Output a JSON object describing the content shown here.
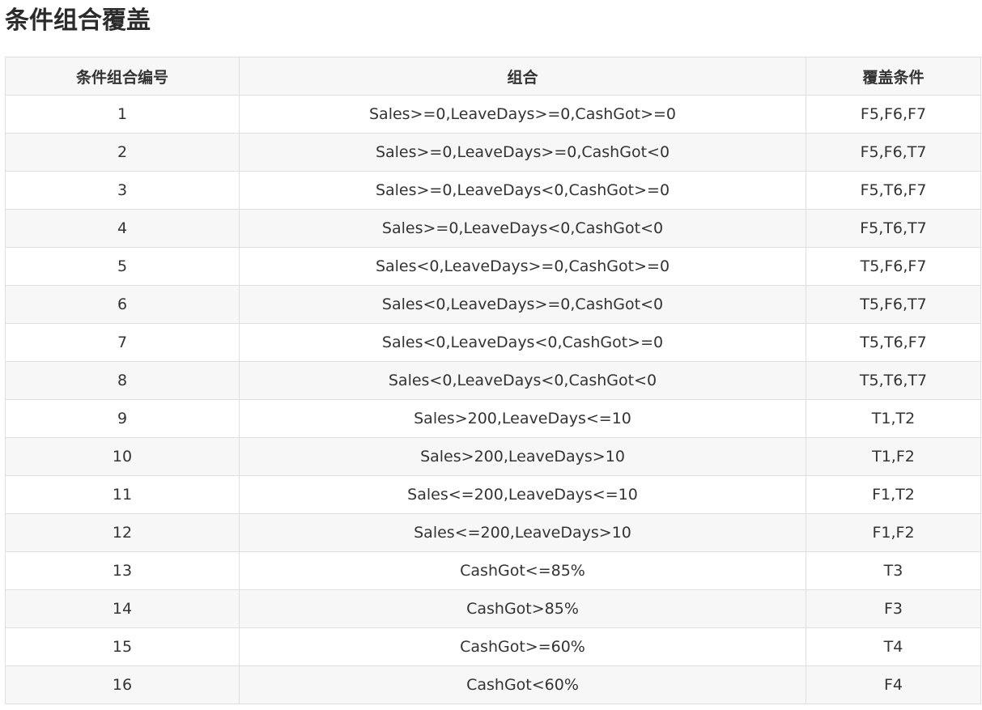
{
  "page": {
    "title": "条件组合覆盖"
  },
  "table": {
    "headers": [
      "条件组合编号",
      "组合",
      "覆盖条件"
    ],
    "rows": [
      {
        "id": "1",
        "combination": "Sales>=0,LeaveDays>=0,CashGot>=0",
        "covered": "F5,F6,F7"
      },
      {
        "id": "2",
        "combination": "Sales>=0,LeaveDays>=0,CashGot<0",
        "covered": "F5,F6,T7"
      },
      {
        "id": "3",
        "combination": "Sales>=0,LeaveDays<0,CashGot>=0",
        "covered": "F5,T6,F7"
      },
      {
        "id": "4",
        "combination": "Sales>=0,LeaveDays<0,CashGot<0",
        "covered": "F5,T6,T7"
      },
      {
        "id": "5",
        "combination": "Sales<0,LeaveDays>=0,CashGot>=0",
        "covered": "T5,F6,F7"
      },
      {
        "id": "6",
        "combination": "Sales<0,LeaveDays>=0,CashGot<0",
        "covered": "T5,F6,T7"
      },
      {
        "id": "7",
        "combination": "Sales<0,LeaveDays<0,CashGot>=0",
        "covered": "T5,T6,F7"
      },
      {
        "id": "8",
        "combination": "Sales<0,LeaveDays<0,CashGot<0",
        "covered": "T5,T6,T7"
      },
      {
        "id": "9",
        "combination": "Sales>200,LeaveDays<=10",
        "covered": "T1,T2"
      },
      {
        "id": "10",
        "combination": "Sales>200,LeaveDays>10",
        "covered": "T1,F2"
      },
      {
        "id": "11",
        "combination": "Sales<=200,LeaveDays<=10",
        "covered": "F1,T2"
      },
      {
        "id": "12",
        "combination": "Sales<=200,LeaveDays>10",
        "covered": "F1,F2"
      },
      {
        "id": "13",
        "combination": "CashGot<=85%",
        "covered": "T3"
      },
      {
        "id": "14",
        "combination": "CashGot>85%",
        "covered": "F3"
      },
      {
        "id": "15",
        "combination": "CashGot>=60%",
        "covered": "T4"
      },
      {
        "id": "16",
        "combination": "CashGot<60%",
        "covered": "F4"
      }
    ]
  }
}
